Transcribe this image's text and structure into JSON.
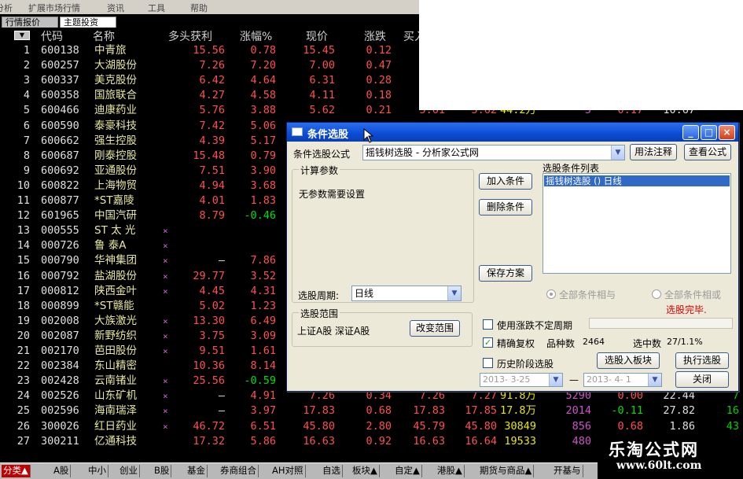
{
  "menu": [
    "分析",
    "扩展市场行情",
    "资讯",
    "工具",
    "帮助"
  ],
  "tabs": [
    "行情报价",
    "主题投资"
  ],
  "headers": [
    "代码",
    "名称",
    "多头获利",
    "涨幅%",
    "现价",
    "涨跌",
    "买入"
  ],
  "rows": [
    {
      "idx": "1",
      "code": "600138",
      "name": "中青旅",
      "mark": "",
      "prof": "15.56",
      "pct": "0.78",
      "price": "15.45",
      "chg": "0.12",
      "bid": "",
      "ask": "",
      "vol": "",
      "cur": "",
      "speed": "",
      "pe": "",
      "last": "",
      "pct_neg": false
    },
    {
      "idx": "2",
      "code": "600257",
      "name": "大湖股份",
      "mark": "",
      "prof": "7.26",
      "pct": "7.20",
      "price": "7.00",
      "chg": "0.47",
      "bid": "",
      "ask": "",
      "vol": "",
      "cur": "",
      "speed": "",
      "pe": "",
      "last": "",
      "pct_neg": false
    },
    {
      "idx": "3",
      "code": "600337",
      "name": "美克股份",
      "mark": "",
      "prof": "6.42",
      "pct": "4.64",
      "price": "6.31",
      "chg": "0.28",
      "bid": "",
      "ask": "",
      "vol": "",
      "cur": "",
      "speed": "",
      "pe": "",
      "last": "",
      "pct_neg": false
    },
    {
      "idx": "4",
      "code": "600358",
      "name": "国旅联合",
      "mark": "",
      "prof": "4.27",
      "pct": "4.58",
      "price": "4.11",
      "chg": "0.18",
      "bid": "",
      "ask": "",
      "vol": "",
      "cur": "",
      "speed": "",
      "pe": "",
      "last": "",
      "pct_neg": false
    },
    {
      "idx": "5",
      "code": "600466",
      "name": "迪康药业",
      "mark": "",
      "prof": "5.76",
      "pct": "3.88",
      "price": "5.62",
      "chg": "0.21",
      "bid": "5.61",
      "ask": "5.62",
      "vol": "44.2万",
      "cur": "5",
      "speed": "0.17",
      "pe": "10.67",
      "last": "",
      "pct_neg": false
    },
    {
      "idx": "6",
      "code": "600590",
      "name": "泰豪科技",
      "mark": "",
      "prof": "7.42",
      "pct": "5.06",
      "price": "",
      "chg": "",
      "bid": "",
      "ask": "",
      "vol": "",
      "cur": "",
      "speed": "",
      "pe": "",
      "last": "",
      "pct_neg": false
    },
    {
      "idx": "7",
      "code": "600662",
      "name": "强生控股",
      "mark": "",
      "prof": "4.39",
      "pct": "5.17",
      "price": "",
      "chg": "",
      "bid": "",
      "ask": "",
      "vol": "",
      "cur": "",
      "speed": "",
      "pe": "",
      "last": "",
      "pct_neg": false
    },
    {
      "idx": "8",
      "code": "600687",
      "name": "刚泰控股",
      "mark": "",
      "prof": "15.48",
      "pct": "0.79",
      "price": "",
      "chg": "",
      "bid": "",
      "ask": "",
      "vol": "",
      "cur": "",
      "speed": "",
      "pe": "",
      "last": "",
      "pct_neg": false
    },
    {
      "idx": "9",
      "code": "600692",
      "name": "亚通股份",
      "mark": "",
      "prof": "7.51",
      "pct": "3.90",
      "price": "",
      "chg": "",
      "bid": "",
      "ask": "",
      "vol": "",
      "cur": "",
      "speed": "",
      "pe": "",
      "last": "",
      "pct_neg": false
    },
    {
      "idx": "10",
      "code": "600822",
      "name": "上海物贸",
      "mark": "",
      "prof": "4.94",
      "pct": "3.68",
      "price": "",
      "chg": "",
      "bid": "",
      "ask": "",
      "vol": "",
      "cur": "",
      "speed": "",
      "pe": "",
      "last": "",
      "pct_neg": false
    },
    {
      "idx": "11",
      "code": "600877",
      "name": "*ST嘉陵",
      "mark": "",
      "prof": "4.01",
      "pct": "1.83",
      "price": "",
      "chg": "",
      "bid": "",
      "ask": "",
      "vol": "",
      "cur": "",
      "speed": "",
      "pe": "",
      "last": "",
      "pct_neg": false
    },
    {
      "idx": "12",
      "code": "601965",
      "name": "中国汽研",
      "mark": "",
      "prof": "8.79",
      "pct": "-0.46",
      "price": "",
      "chg": "",
      "bid": "",
      "ask": "",
      "vol": "",
      "cur": "",
      "speed": "",
      "pe": "",
      "last": "",
      "pct_neg": true
    },
    {
      "idx": "13",
      "code": "000555",
      "name": "ST 太 光",
      "mark": "×",
      "prof": "",
      "pct": "",
      "price": "",
      "chg": "",
      "bid": "",
      "ask": "",
      "vol": "",
      "cur": "",
      "speed": "",
      "pe": "",
      "last": "",
      "pct_neg": false
    },
    {
      "idx": "14",
      "code": "000726",
      "name": "鲁  泰A",
      "mark": "×",
      "prof": "",
      "pct": "",
      "price": "",
      "chg": "",
      "bid": "",
      "ask": "",
      "vol": "",
      "cur": "",
      "speed": "",
      "pe": "",
      "last": "",
      "pct_neg": false
    },
    {
      "idx": "15",
      "code": "000790",
      "name": "华神集团",
      "mark": "×",
      "prof": "—",
      "pct": "7.86",
      "price": "",
      "chg": "",
      "bid": "",
      "ask": "",
      "vol": "",
      "cur": "",
      "speed": "",
      "pe": "",
      "last": "",
      "pct_neg": false
    },
    {
      "idx": "16",
      "code": "000792",
      "name": "盐湖股份",
      "mark": "×",
      "prof": "29.77",
      "pct": "3.52",
      "price": "",
      "chg": "",
      "bid": "",
      "ask": "",
      "vol": "",
      "cur": "",
      "speed": "",
      "pe": "",
      "last": "",
      "pct_neg": false
    },
    {
      "idx": "17",
      "code": "000812",
      "name": "陕西金叶",
      "mark": "×",
      "prof": "4.45",
      "pct": "4.31",
      "price": "",
      "chg": "",
      "bid": "",
      "ask": "",
      "vol": "",
      "cur": "",
      "speed": "",
      "pe": "",
      "last": "",
      "pct_neg": false
    },
    {
      "idx": "18",
      "code": "000899",
      "name": "*ST赣能",
      "mark": "",
      "prof": "5.02",
      "pct": "1.23",
      "price": "",
      "chg": "",
      "bid": "",
      "ask": "",
      "vol": "",
      "cur": "",
      "speed": "",
      "pe": "",
      "last": "",
      "pct_neg": false
    },
    {
      "idx": "19",
      "code": "002008",
      "name": "大族激光",
      "mark": "×",
      "prof": "13.30",
      "pct": "6.49",
      "price": "",
      "chg": "",
      "bid": "",
      "ask": "",
      "vol": "",
      "cur": "",
      "speed": "",
      "pe": "",
      "last": "",
      "pct_neg": false
    },
    {
      "idx": "20",
      "code": "002087",
      "name": "新野纺织",
      "mark": "×",
      "prof": "3.75",
      "pct": "3.09",
      "price": "",
      "chg": "",
      "bid": "",
      "ask": "",
      "vol": "",
      "cur": "",
      "speed": "",
      "pe": "",
      "last": "",
      "pct_neg": false
    },
    {
      "idx": "21",
      "code": "002170",
      "name": "芭田股份",
      "mark": "×",
      "prof": "9.51",
      "pct": "1.61",
      "price": "",
      "chg": "",
      "bid": "",
      "ask": "",
      "vol": "",
      "cur": "",
      "speed": "",
      "pe": "",
      "last": "",
      "pct_neg": false
    },
    {
      "idx": "22",
      "code": "002384",
      "name": "东山精密",
      "mark": "",
      "prof": "10.36",
      "pct": "8.14",
      "price": "",
      "chg": "",
      "bid": "",
      "ask": "",
      "vol": "",
      "cur": "",
      "speed": "",
      "pe": "",
      "last": "",
      "pct_neg": false
    },
    {
      "idx": "23",
      "code": "002428",
      "name": "云南锗业",
      "mark": "×",
      "prof": "25.56",
      "pct": "-0.59",
      "price": "",
      "chg": "",
      "bid": "",
      "ask": "",
      "vol": "",
      "cur": "",
      "speed": "",
      "pe": "",
      "last": "",
      "pct_neg": true
    },
    {
      "idx": "24",
      "code": "002526",
      "name": "山东矿机",
      "mark": "×",
      "prof": "—",
      "pct": "4.91",
      "price": "7.26",
      "chg": "0.34",
      "bid": "7.26",
      "ask": "7.27",
      "vol": "91.8万",
      "cur": "5290",
      "speed": "0.00",
      "pe": "22.44",
      "last": "7",
      "pct_neg": false
    },
    {
      "idx": "25",
      "code": "002596",
      "name": "海南瑞泽",
      "mark": "×",
      "prof": "—",
      "pct": "3.97",
      "price": "17.83",
      "chg": "0.68",
      "bid": "17.83",
      "ask": "17.85",
      "vol": "17.8万",
      "cur": "2014",
      "speed": "-0.11",
      "pe": "27.82",
      "last": "16",
      "pct_neg": false,
      "speed_neg": true
    },
    {
      "idx": "26",
      "code": "300026",
      "name": "红日药业",
      "mark": "×",
      "prof": "46.72",
      "pct": "6.51",
      "price": "45.80",
      "chg": "2.80",
      "bid": "45.79",
      "ask": "45.80",
      "vol": "30849",
      "cur": "856",
      "speed": "0.68",
      "pe": "1.86",
      "last": "43",
      "pct_neg": false
    },
    {
      "idx": "27",
      "code": "300211",
      "name": "亿通科技",
      "mark": "",
      "prof": "17.32",
      "pct": "5.86",
      "price": "16.63",
      "chg": "0.92",
      "bid": "16.63",
      "ask": "16.64",
      "vol": "19533",
      "cur": "480",
      "speed": "",
      "pe": "",
      "last": "",
      "pct_neg": false
    }
  ],
  "bottom_tabs": [
    "分类▲",
    "A股",
    "中小",
    "创业",
    "B股",
    "基金",
    "券商组合",
    "AH对照",
    "自选",
    "板块▲",
    "自定▲",
    "港股▲",
    "期货与商品▲",
    "开基与"
  ],
  "dialog": {
    "title": "条件选股",
    "formula_label": "条件选股公式",
    "formula_value": "摇钱树选股 - 分析家公式网",
    "btn_usage": "用法注释",
    "btn_view": "查看公式",
    "params_group": "计算参数",
    "params_text": "无参数需要设置",
    "btn_add": "加入条件",
    "btn_delete": "删除条件",
    "list_title": "选股条件列表",
    "list_item": "摇钱树选股 () 日线",
    "btn_save": "保存方案",
    "period_label": "选股周期:",
    "period_value": "日线",
    "radio_and": "全部条件相与",
    "radio_or": "全部条件相或",
    "status": "选股完毕.",
    "range_group": "选股范围",
    "range_text": "上证A股 深证A股",
    "btn_change_range": "改变范围",
    "chk_uncertain": "使用涨跌不定周期",
    "chk_exact": "精确复权",
    "count_label": "品种数",
    "count_value": "2464",
    "selected_label": "选中数",
    "selected_value": "27/1.1%",
    "chk_history": "历史阶段选股",
    "btn_to_block": "选股入板块",
    "btn_execute": "执行选股",
    "date_from": "2013- 3-25",
    "date_sep": "—",
    "date_to": "2013- 4- 1",
    "btn_close": "关闭"
  },
  "watermark": {
    "title": "乐淘公式网",
    "url": "www.60lt.com"
  }
}
